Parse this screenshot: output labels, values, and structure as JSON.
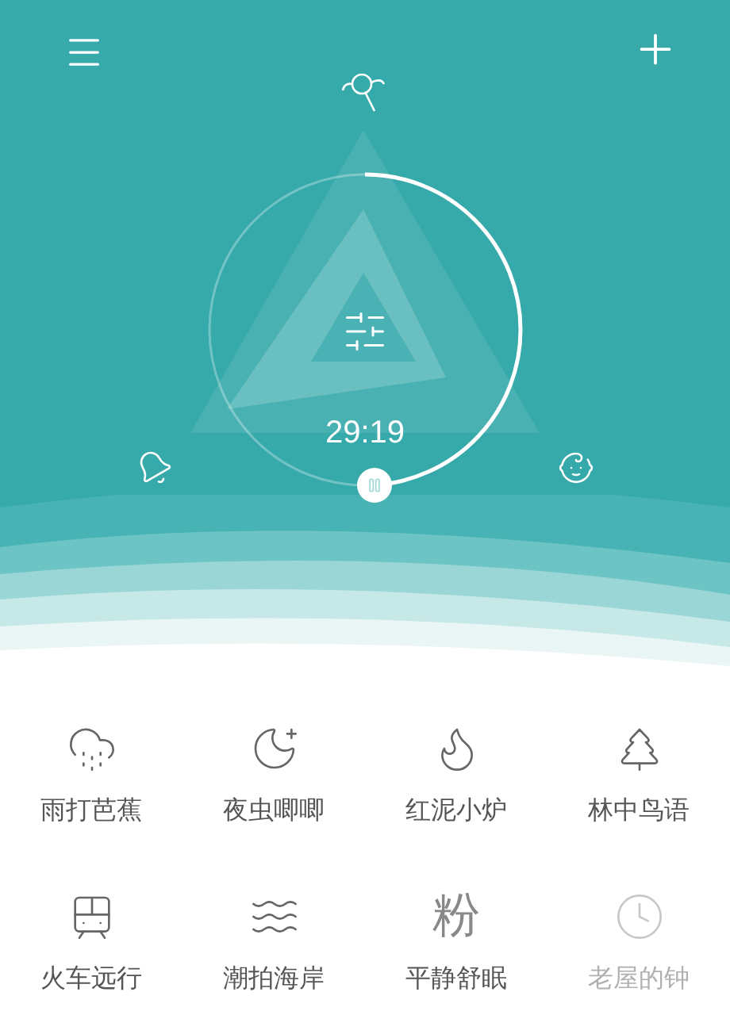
{
  "timer": {
    "time": "29:19"
  },
  "sounds": [
    {
      "kind": "icon",
      "label": "雨打芭蕉",
      "disabled": false
    },
    {
      "kind": "icon",
      "label": "夜虫唧唧",
      "disabled": false
    },
    {
      "kind": "icon",
      "label": "红泥小炉",
      "disabled": false
    },
    {
      "kind": "icon",
      "label": "林中鸟语",
      "disabled": false
    },
    {
      "kind": "icon",
      "label": "火车远行",
      "disabled": false
    },
    {
      "kind": "icon",
      "label": "潮拍海岸",
      "disabled": false
    },
    {
      "kind": "glyph",
      "glyph": "粉",
      "label": "平静舒眠",
      "disabled": false
    },
    {
      "kind": "icon",
      "label": "老屋的钟",
      "disabled": true
    }
  ]
}
